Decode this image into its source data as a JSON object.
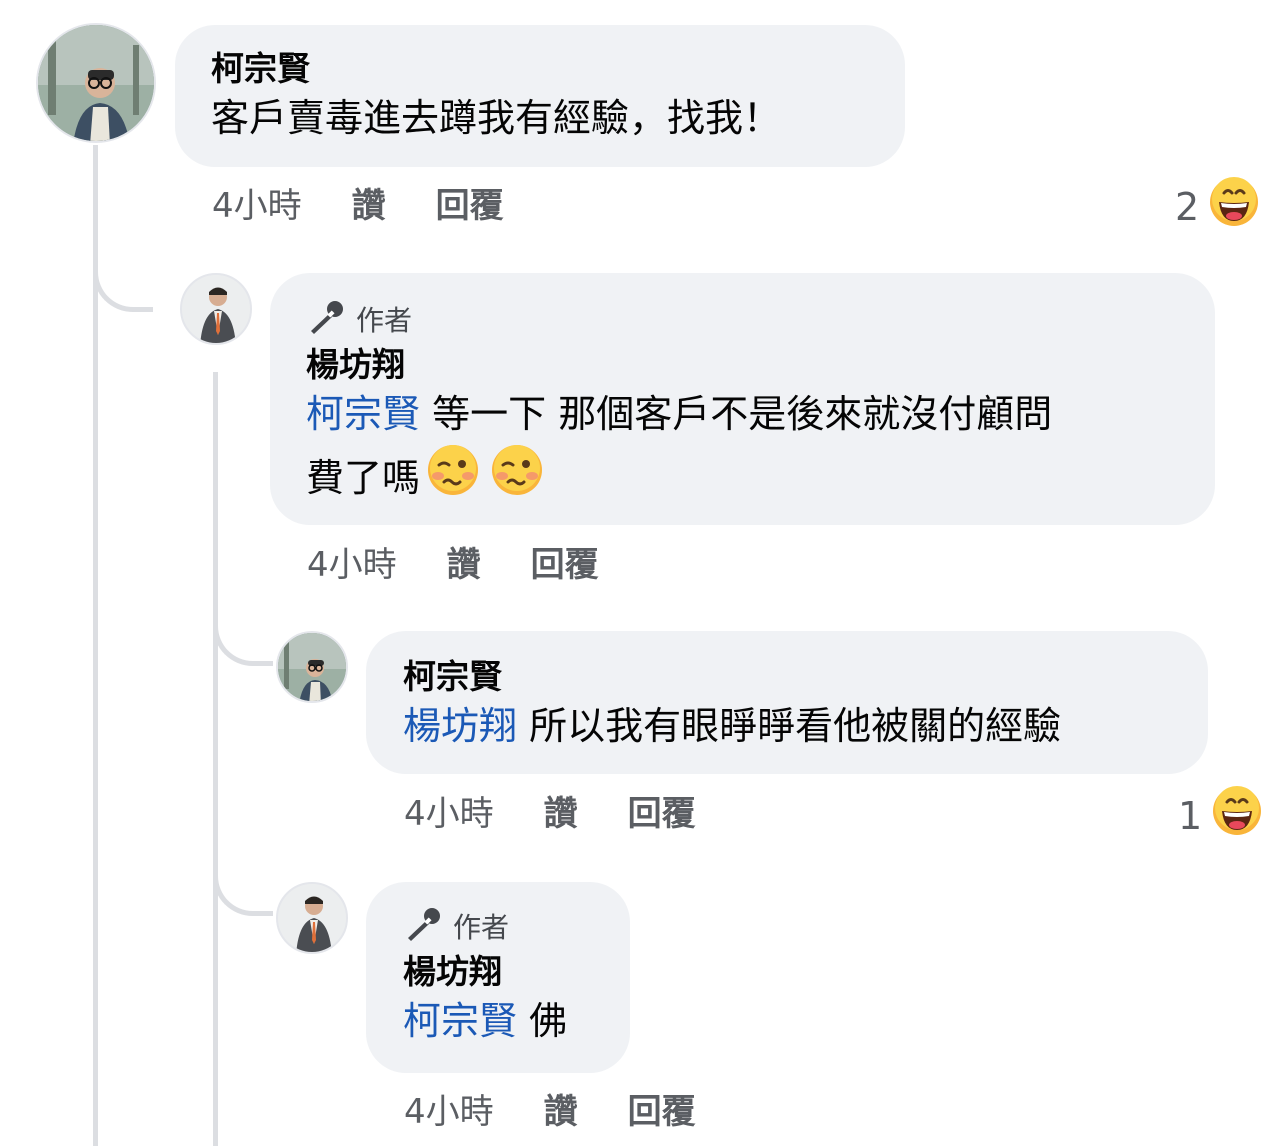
{
  "comments": [
    {
      "name": "柯宗賢",
      "text": "客戶賣毒進去蹲我有經驗，找我！",
      "time": "4小時",
      "like": "讚",
      "reply": "回覆",
      "reaction_count": "2"
    },
    {
      "author_badge": "作者",
      "name": "楊坊翔",
      "mention": "柯宗賢",
      "text_line1": "等一下 那個客戶不是後來就沒付顧問",
      "text_line2": "費了嗎",
      "time": "4小時",
      "like": "讚",
      "reply": "回覆"
    },
    {
      "name": "柯宗賢",
      "mention": "楊坊翔",
      "text": "所以我有眼睜睜看他被關的經驗",
      "time": "4小時",
      "like": "讚",
      "reply": "回覆",
      "reaction_count": "1"
    },
    {
      "author_badge": "作者",
      "name": "楊坊翔",
      "mention": "柯宗賢",
      "text": "佛",
      "time": "4小時",
      "like": "讚",
      "reply": "回覆"
    }
  ],
  "icons": {
    "reaction": "haha-emoji-icon",
    "woozy": "woozy-face-emoji",
    "author": "microphone-icon"
  },
  "colors": {
    "bubble": "#f0f2f5",
    "mention": "#1b59b6",
    "muted": "#5b5e63"
  }
}
